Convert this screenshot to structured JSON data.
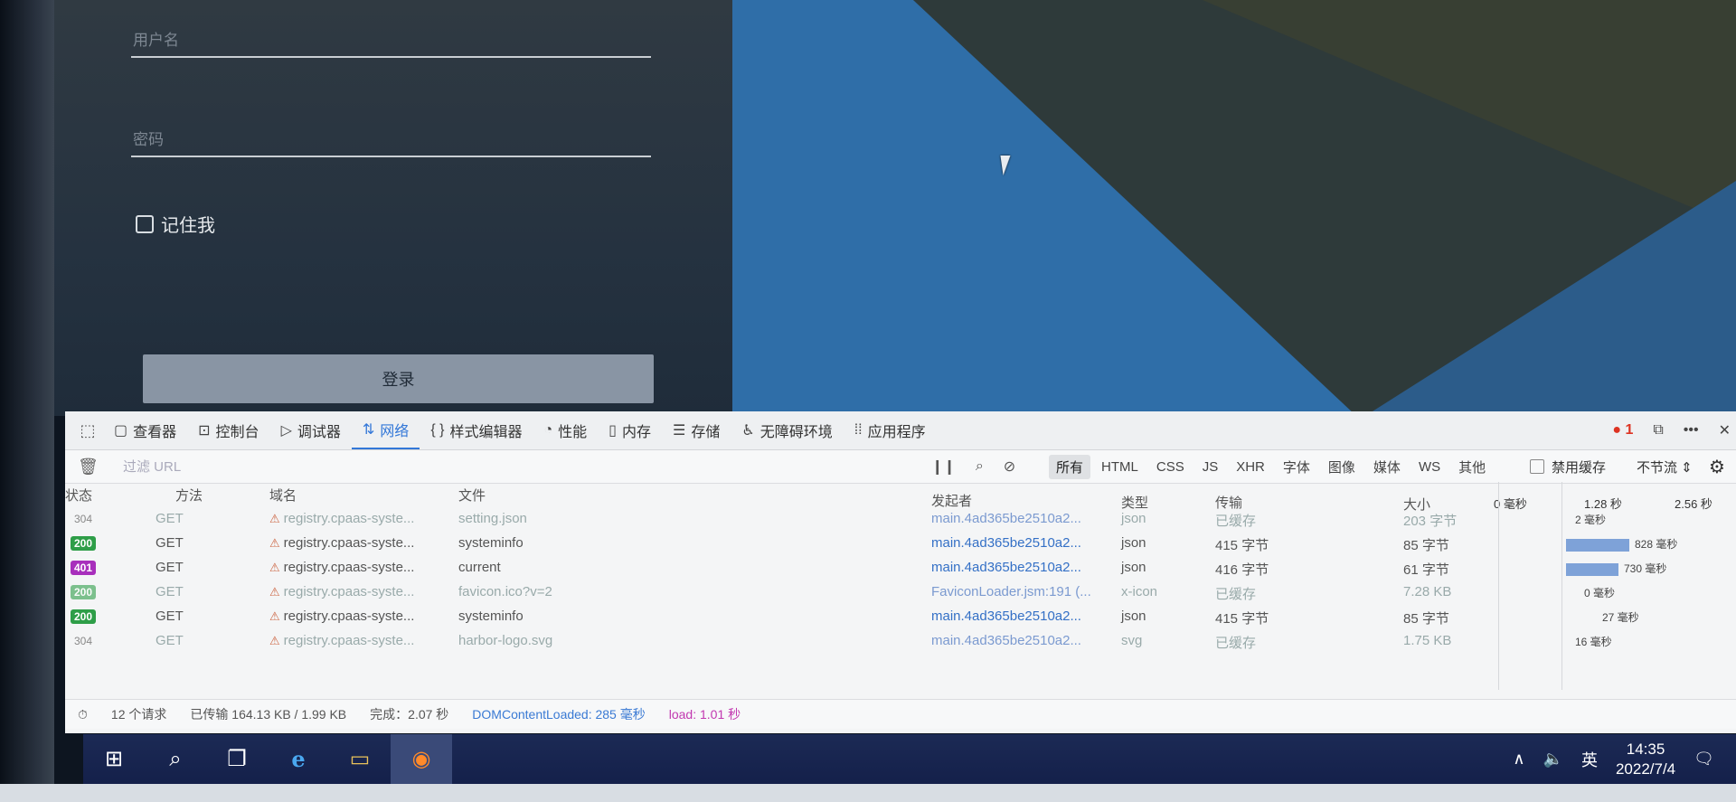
{
  "login": {
    "username_placeholder": "用户名",
    "password_placeholder": "密码",
    "remember_label": "记住我",
    "login_button": "登录"
  },
  "devtools": {
    "tabs": [
      {
        "icon": "inspector-icon",
        "glyph": "▢",
        "label": "查看器"
      },
      {
        "icon": "console-icon",
        "glyph": "⊡",
        "label": "控制台"
      },
      {
        "icon": "debugger-icon",
        "glyph": "▷",
        "label": "调试器"
      },
      {
        "icon": "network-icon",
        "glyph": "⇅",
        "label": "网络"
      },
      {
        "icon": "style-editor-icon",
        "glyph": "{ }",
        "label": "样式编辑器"
      },
      {
        "icon": "performance-icon",
        "glyph": "◔",
        "label": "性能"
      },
      {
        "icon": "memory-icon",
        "glyph": "▯",
        "label": "内存"
      },
      {
        "icon": "storage-icon",
        "glyph": "☰",
        "label": "存储"
      },
      {
        "icon": "accessibility-icon",
        "glyph": "♿",
        "label": "无障碍环境"
      },
      {
        "icon": "application-icon",
        "glyph": "⁞⁞",
        "label": "应用程序"
      }
    ],
    "active_tab": "网络",
    "error_count": "1",
    "filter_placeholder": "过滤 URL",
    "type_filters": [
      "所有",
      "HTML",
      "CSS",
      "JS",
      "XHR",
      "字体",
      "图像",
      "媒体",
      "WS",
      "其他"
    ],
    "active_type_filter": "所有",
    "disable_cache_label": "禁用缓存",
    "throttle_label": "不节流 ⇕",
    "columns": {
      "status": "状态",
      "method": "方法",
      "domain": "域名",
      "file": "文件",
      "initiator": "发起者",
      "type": "类型",
      "transferred": "传输",
      "size": "大小"
    },
    "waterfall_ticks": [
      "0 毫秒",
      "1.28 秒",
      "2.56 秒"
    ],
    "rows": [
      {
        "status": "304",
        "method": "GET",
        "domain": "registry.cpaas-syste...",
        "file": "setting.json",
        "initiator": "main.4ad365be2510a2...",
        "type": "json",
        "transferred": "已缓存",
        "size": "203 字节",
        "timing": "2 毫秒",
        "faded": true
      },
      {
        "status": "200",
        "method": "GET",
        "domain": "registry.cpaas-syste...",
        "file": "systeminfo",
        "initiator": "main.4ad365be2510a2...",
        "type": "json",
        "transferred": "415 字节",
        "size": "85 字节",
        "timing": "828 毫秒",
        "faded": false
      },
      {
        "status": "401",
        "method": "GET",
        "domain": "registry.cpaas-syste...",
        "file": "current",
        "initiator": "main.4ad365be2510a2...",
        "type": "json",
        "transferred": "416 字节",
        "size": "61 字节",
        "timing": "730 毫秒",
        "faded": false
      },
      {
        "status": "200",
        "method": "GET",
        "domain": "registry.cpaas-syste...",
        "file": "favicon.ico?v=2",
        "initiator": "FaviconLoader.jsm:191 (...",
        "type": "x-icon",
        "transferred": "已缓存",
        "size": "7.28 KB",
        "timing": "0 毫秒",
        "faded": true
      },
      {
        "status": "200",
        "method": "GET",
        "domain": "registry.cpaas-syste...",
        "file": "systeminfo",
        "initiator": "main.4ad365be2510a2...",
        "type": "json",
        "transferred": "415 字节",
        "size": "85 字节",
        "timing": "27 毫秒",
        "faded": false
      },
      {
        "status": "304",
        "method": "GET",
        "domain": "registry.cpaas-syste...",
        "file": "harbor-logo.svg",
        "initiator": "main.4ad365be2510a2...",
        "type": "svg",
        "transferred": "已缓存",
        "size": "1.75 KB",
        "timing": "16 毫秒",
        "faded": true
      }
    ],
    "summary": {
      "requests": "12 个请求",
      "transferred": "已传输 164.13 KB / 1.99 KB",
      "finish": "完成：2.07 秒",
      "dom_content_loaded": "DOMContentLoaded: 285 毫秒",
      "load": "load: 1.01 秒"
    }
  },
  "taskbar": {
    "ime": "英",
    "time": "14:35",
    "date": "2022/7/4"
  }
}
